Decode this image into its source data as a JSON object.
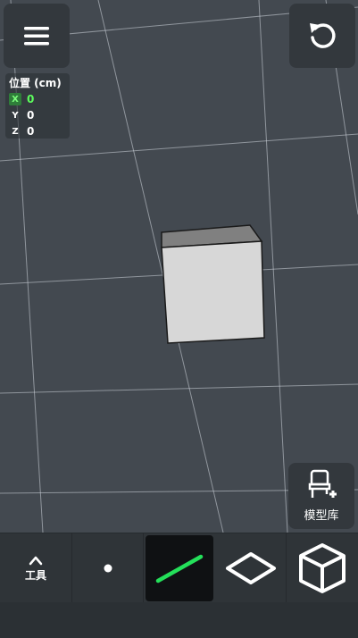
{
  "colors": {
    "background": "#434950",
    "grid_line": "#cfd6dc",
    "panel": "#33383d",
    "accent_green": "#24e05a",
    "cube_front": "#d7d7d7",
    "cube_top": "#808080"
  },
  "header": {
    "menu_icon": "hamburger-icon",
    "undo_icon": "undo-icon"
  },
  "coordinates": {
    "title": "位置 (cm)",
    "rows": [
      {
        "axis": "X",
        "value": "0",
        "active": true
      },
      {
        "axis": "Y",
        "value": "0",
        "active": false
      },
      {
        "axis": "Z",
        "value": "0",
        "active": false
      }
    ]
  },
  "library": {
    "icon": "chair-plus-icon",
    "label": "模型库"
  },
  "toolbar": {
    "tools_icon": "chevron-up-icon",
    "tools_label": "工具",
    "items": [
      {
        "name": "point",
        "icon": "point-icon"
      },
      {
        "name": "line",
        "icon": "line-icon",
        "selected": true
      },
      {
        "name": "plane",
        "icon": "plane-icon"
      },
      {
        "name": "box",
        "icon": "cube-icon"
      }
    ]
  }
}
